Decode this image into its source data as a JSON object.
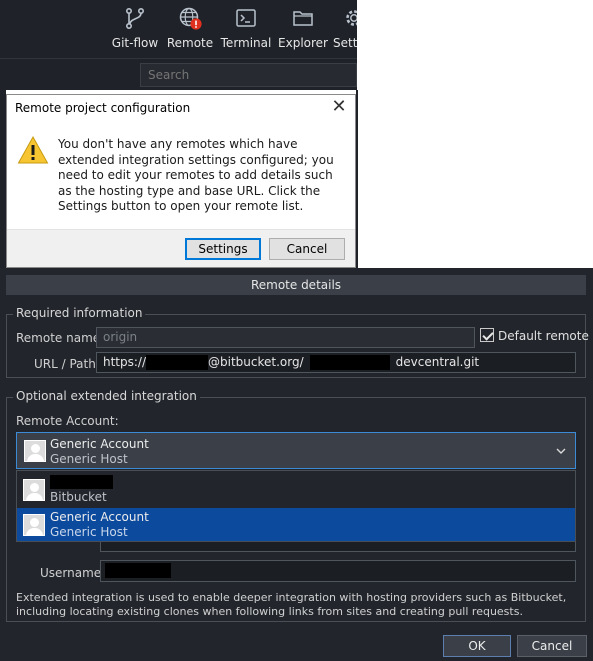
{
  "toolbar": {
    "items": [
      {
        "label": "Git-flow",
        "icon": "git-flow-icon"
      },
      {
        "label": "Remote",
        "icon": "globe-icon",
        "badge": "!"
      },
      {
        "label": "Terminal",
        "icon": "terminal-icon"
      },
      {
        "label": "Explorer",
        "icon": "folder-icon"
      },
      {
        "label": "Setti",
        "icon": "gear-icon"
      }
    ],
    "search_placeholder": "Search"
  },
  "dialog": {
    "title": "Remote project configuration",
    "close_glyph": "✕",
    "message": "You don't have any remotes which have extended integration settings configured; you need to edit your remotes to add details such as the hosting type and base URL. Click the Settings button to open your remote list.",
    "settings_label": "Settings",
    "cancel_label": "Cancel"
  },
  "details": {
    "header": "Remote details",
    "required_legend": "Required information",
    "remote_name_label": "Remote name:",
    "remote_name_value": "origin",
    "default_remote_label": "Default remote",
    "default_remote_checked": true,
    "url_label": "URL / Path:",
    "url_prefix": "https://",
    "url_middle": "@bitbucket.org/",
    "url_suffix": "devcentral.git",
    "optional_legend": "Optional extended integration",
    "remote_account_label": "Remote Account:",
    "selected_account": {
      "name": "Generic Account",
      "host": "Generic Host"
    },
    "account_options": [
      {
        "name": "",
        "host": "Bitbucket"
      },
      {
        "name": "Generic Account",
        "host": "Generic Host"
      }
    ],
    "username_label": "Username:",
    "info_text": "Extended integration is used to enable deeper integration with hosting providers such as Bitbucket, including locating existing clones when following links from sites and creating pull requests.",
    "ok_label": "OK",
    "cancel_label": "Cancel"
  },
  "colors": {
    "dark_bg": "#22262c",
    "selection": "#0c4a9e",
    "focus": "#0078d7",
    "badge": "#e0301e",
    "warning": "#f7c531"
  }
}
